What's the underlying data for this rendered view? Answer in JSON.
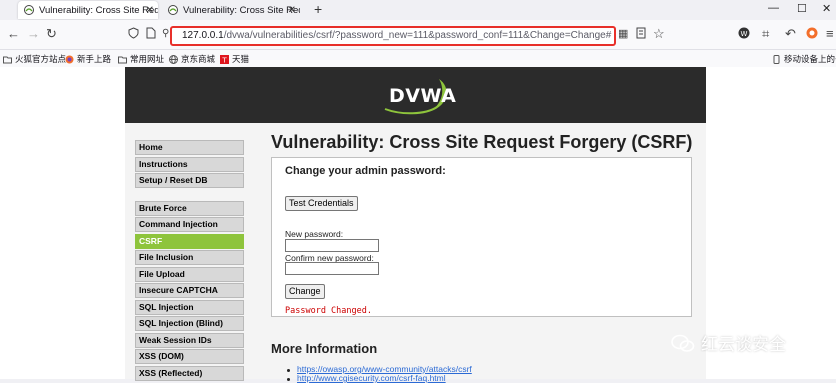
{
  "tabs": [
    {
      "title": "Vulnerability: Cross Site Requ",
      "active": true
    },
    {
      "title": "Vulnerability: Cross Site Requ",
      "active": false
    }
  ],
  "new_tab": "+",
  "window_controls": {
    "minimize": "—",
    "maximize": "☐",
    "close": "✕"
  },
  "url": {
    "host": "127.0.0.1",
    "path": "/dvwa/vulnerabilities/csrf/?password_new=111&password_conf=111&Change=Change#"
  },
  "bookmarks": [
    "火狐官方站点",
    "新手上路",
    "常用网址",
    "京东商城",
    "天猫"
  ],
  "mobile_bookmarks": "移动设备上的书签",
  "logo_text": "DVWA",
  "menu": {
    "group1": [
      "Home",
      "Instructions",
      "Setup / Reset DB"
    ],
    "group2": [
      "Brute Force",
      "Command Injection",
      "CSRF",
      "File Inclusion",
      "File Upload",
      "Insecure CAPTCHA",
      "SQL Injection",
      "SQL Injection (Blind)",
      "Weak Session IDs",
      "XSS (DOM)",
      "XSS (Reflected)"
    ],
    "selected": "CSRF"
  },
  "page_title": "Vulnerability: Cross Site Request Forgery (CSRF)",
  "form": {
    "heading": "Change your admin password:",
    "test_button": "Test Credentials",
    "new_password_label": "New password:",
    "confirm_password_label": "Confirm new password:",
    "new_password_value": "",
    "confirm_password_value": "",
    "change_button": "Change",
    "result": "Password Changed."
  },
  "more_info": {
    "title": "More Information",
    "links": [
      "https://owasp.org/www-community/attacks/csrf",
      "http://www.cgisecurity.com/csrf-faq.html"
    ]
  },
  "watermark": "红云谈安全",
  "colors": {
    "url_highlight": "#e8302a",
    "menu_selected": "#8ec43c",
    "result_text": "#cc0000"
  }
}
